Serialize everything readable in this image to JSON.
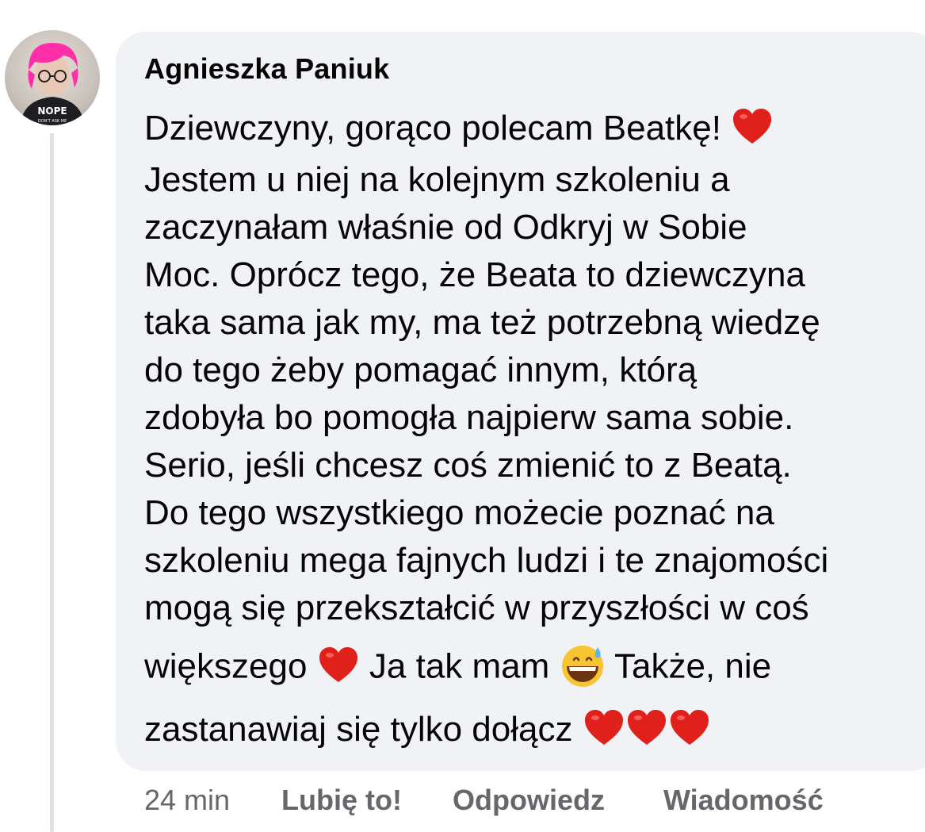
{
  "comment": {
    "author": "Agnieszka Paniuk",
    "lines": [
      "Dziewczyny, gorąco polecam Beatkę!",
      "Jestem u niej na kolejnym szkoleniu a",
      "zaczynałam właśnie od Odkryj w Sobie",
      "Moc. Oprócz tego, że Beata to dziewczyna",
      "taka sama jak my, ma też potrzebną wiedzę",
      "do tego żeby pomagać innym, którą",
      "zdobyła bo pomogła najpierw sama sobie.",
      "Serio, jeśli chcesz coś zmienić to z Beatą.",
      "Do tego wszystkiego możecie poznać na",
      "szkoleniu mega fajnych ludzi i te znajomości",
      "mogą się przekształcić w przyszłości w coś"
    ],
    "line12_part1": "większego",
    "line12_part2": "Ja tak mam",
    "line12_part3": "Także, nie",
    "line13": "zastanawiaj się tylko dołącz",
    "emoji": {
      "heart": "red-heart",
      "smile": "grinning-face-with-sweat"
    }
  },
  "avatar": {
    "shirt_text": "NOPE",
    "shirt_subtext": "DON'T ASK ME"
  },
  "footer": {
    "timestamp": "24 min",
    "like_label": "Lubię to!",
    "reply_label": "Odpowiedz",
    "message_label": "Wiadomość"
  },
  "colors": {
    "bubble": "#f0f2f5",
    "text": "#050505",
    "secondary": "#65676b",
    "heart": "#e0201b",
    "hair": "#ff2fa8"
  }
}
